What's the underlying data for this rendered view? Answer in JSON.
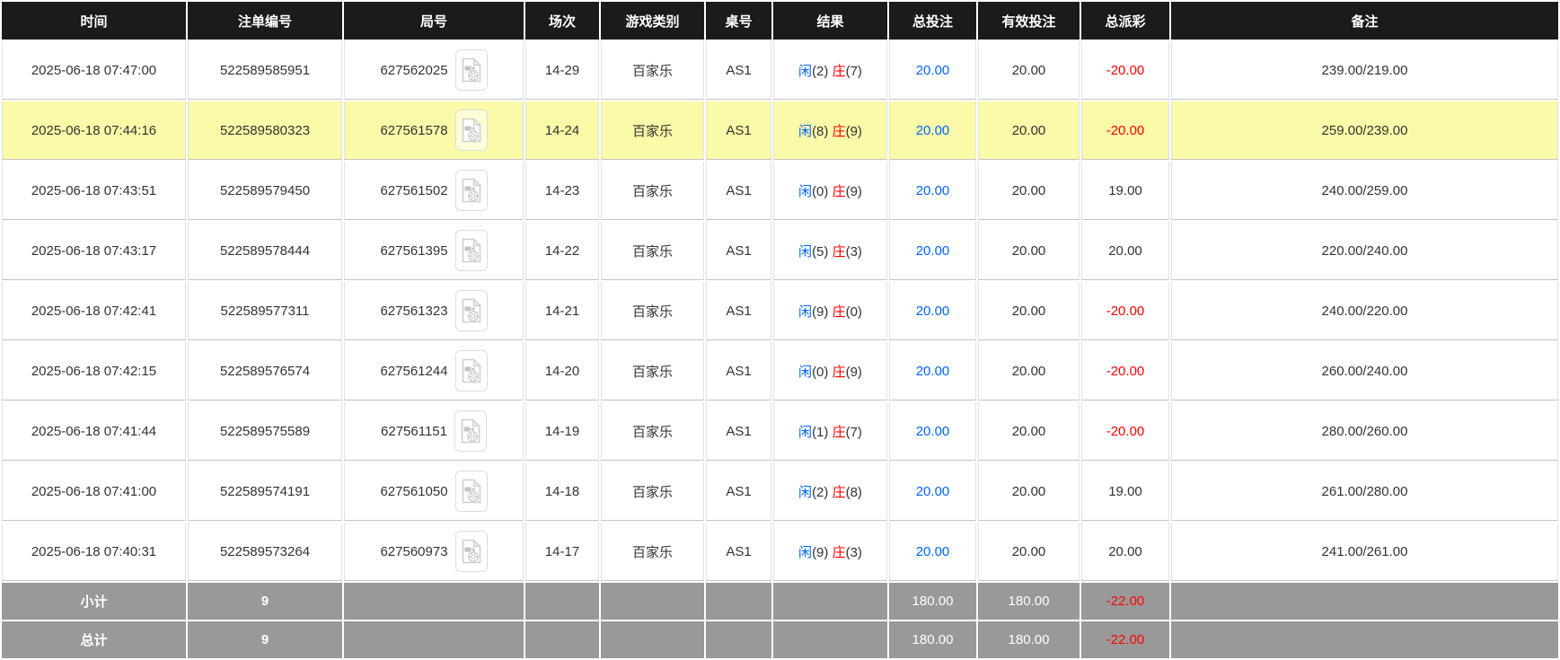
{
  "colors": {
    "header_bg": "#1b1b1b",
    "header_text": "#ffffff",
    "row_highlight": "#fafaa8",
    "footer_bg": "#999999",
    "accent_blue": "#0066ff",
    "negative_red": "#ff0000",
    "body_text": "#333333"
  },
  "table": {
    "headers": [
      "时间",
      "注单编号",
      "局号",
      "场次",
      "游戏类别",
      "桌号",
      "结果",
      "总投注",
      "有效投注",
      "总派彩",
      "备注"
    ],
    "rows": [
      {
        "time": "2025-06-18 07:47:00",
        "bet_id": "522589585951",
        "round_id": "627562025",
        "session": "14-29",
        "game_type": "百家乐",
        "table_no": "AS1",
        "result": {
          "p_label": "闲",
          "p_score": "(2)",
          "b_label": "庄",
          "b_score": "(7)"
        },
        "total_bet": "20.00",
        "valid_bet": "20.00",
        "payout": "-20.00",
        "remark": "239.00/219.00",
        "highlighted": false
      },
      {
        "time": "2025-06-18 07:44:16",
        "bet_id": "522589580323",
        "round_id": "627561578",
        "session": "14-24",
        "game_type": "百家乐",
        "table_no": "AS1",
        "result": {
          "p_label": "闲",
          "p_score": "(8)",
          "b_label": "庄",
          "b_score": "(9)"
        },
        "total_bet": "20.00",
        "valid_bet": "20.00",
        "payout": "-20.00",
        "remark": "259.00/239.00",
        "highlighted": true
      },
      {
        "time": "2025-06-18 07:43:51",
        "bet_id": "522589579450",
        "round_id": "627561502",
        "session": "14-23",
        "game_type": "百家乐",
        "table_no": "AS1",
        "result": {
          "p_label": "闲",
          "p_score": "(0)",
          "b_label": "庄",
          "b_score": "(9)"
        },
        "total_bet": "20.00",
        "valid_bet": "20.00",
        "payout": "19.00",
        "remark": "240.00/259.00",
        "highlighted": false
      },
      {
        "time": "2025-06-18 07:43:17",
        "bet_id": "522589578444",
        "round_id": "627561395",
        "session": "14-22",
        "game_type": "百家乐",
        "table_no": "AS1",
        "result": {
          "p_label": "闲",
          "p_score": "(5)",
          "b_label": "庄",
          "b_score": "(3)"
        },
        "total_bet": "20.00",
        "valid_bet": "20.00",
        "payout": "20.00",
        "remark": "220.00/240.00",
        "highlighted": false
      },
      {
        "time": "2025-06-18 07:42:41",
        "bet_id": "522589577311",
        "round_id": "627561323",
        "session": "14-21",
        "game_type": "百家乐",
        "table_no": "AS1",
        "result": {
          "p_label": "闲",
          "p_score": "(9)",
          "b_label": "庄",
          "b_score": "(0)"
        },
        "total_bet": "20.00",
        "valid_bet": "20.00",
        "payout": "-20.00",
        "remark": "240.00/220.00",
        "highlighted": false
      },
      {
        "time": "2025-06-18 07:42:15",
        "bet_id": "522589576574",
        "round_id": "627561244",
        "session": "14-20",
        "game_type": "百家乐",
        "table_no": "AS1",
        "result": {
          "p_label": "闲",
          "p_score": "(0)",
          "b_label": "庄",
          "b_score": "(9)"
        },
        "total_bet": "20.00",
        "valid_bet": "20.00",
        "payout": "-20.00",
        "remark": "260.00/240.00",
        "highlighted": false
      },
      {
        "time": "2025-06-18 07:41:44",
        "bet_id": "522589575589",
        "round_id": "627561151",
        "session": "14-19",
        "game_type": "百家乐",
        "table_no": "AS1",
        "result": {
          "p_label": "闲",
          "p_score": "(1)",
          "b_label": "庄",
          "b_score": "(7)"
        },
        "total_bet": "20.00",
        "valid_bet": "20.00",
        "payout": "-20.00",
        "remark": "280.00/260.00",
        "highlighted": false
      },
      {
        "time": "2025-06-18 07:41:00",
        "bet_id": "522589574191",
        "round_id": "627561050",
        "session": "14-18",
        "game_type": "百家乐",
        "table_no": "AS1",
        "result": {
          "p_label": "闲",
          "p_score": "(2)",
          "b_label": "庄",
          "b_score": "(8)"
        },
        "total_bet": "20.00",
        "valid_bet": "20.00",
        "payout": "19.00",
        "remark": "261.00/280.00",
        "highlighted": false
      },
      {
        "time": "2025-06-18 07:40:31",
        "bet_id": "522589573264",
        "round_id": "627560973",
        "session": "14-17",
        "game_type": "百家乐",
        "table_no": "AS1",
        "result": {
          "p_label": "闲",
          "p_score": "(9)",
          "b_label": "庄",
          "b_score": "(3)"
        },
        "total_bet": "20.00",
        "valid_bet": "20.00",
        "payout": "20.00",
        "remark": "241.00/261.00",
        "highlighted": false
      }
    ],
    "footer": {
      "subtotal": {
        "label": "小计",
        "count": "9",
        "total_bet": "180.00",
        "valid_bet": "180.00",
        "payout": "-22.00"
      },
      "grand_total": {
        "label": "总计",
        "count": "9",
        "total_bet": "180.00",
        "valid_bet": "180.00",
        "payout": "-22.00"
      }
    }
  }
}
